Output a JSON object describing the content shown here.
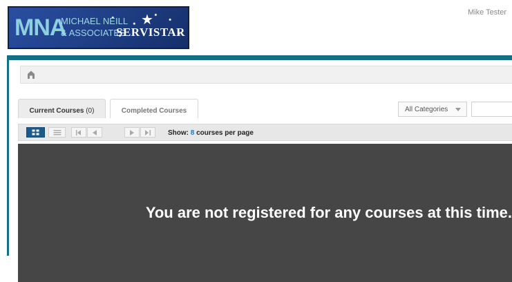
{
  "logo": {
    "mna": "MNA",
    "line1": "MICHAEL NEILL",
    "line2": "& ASSOCIATES",
    "brand": "SERVISTAR"
  },
  "user": {
    "name": "Mike Tester"
  },
  "tabs": [
    {
      "label": "Current Courses",
      "count": "(0)",
      "active": true
    },
    {
      "label": "Completed Courses",
      "active": false
    }
  ],
  "category_select": {
    "value": "All Categories"
  },
  "toolbar": {
    "show_label": "Show:",
    "per_page_value": "8",
    "per_page_suffix": "courses per page"
  },
  "content": {
    "message": "You are not registered for any courses at this time."
  },
  "colors": {
    "frame_accent": "#136f85",
    "content_bg": "#464646",
    "active_view": "#1c5a8a",
    "link_blue": "#1c7bbd"
  },
  "icons": [
    "home-icon",
    "grid-view-icon",
    "list-view-icon",
    "first-page-icon",
    "prev-page-icon",
    "next-page-icon",
    "last-page-icon",
    "star-icon",
    "chevron-down-icon"
  ]
}
